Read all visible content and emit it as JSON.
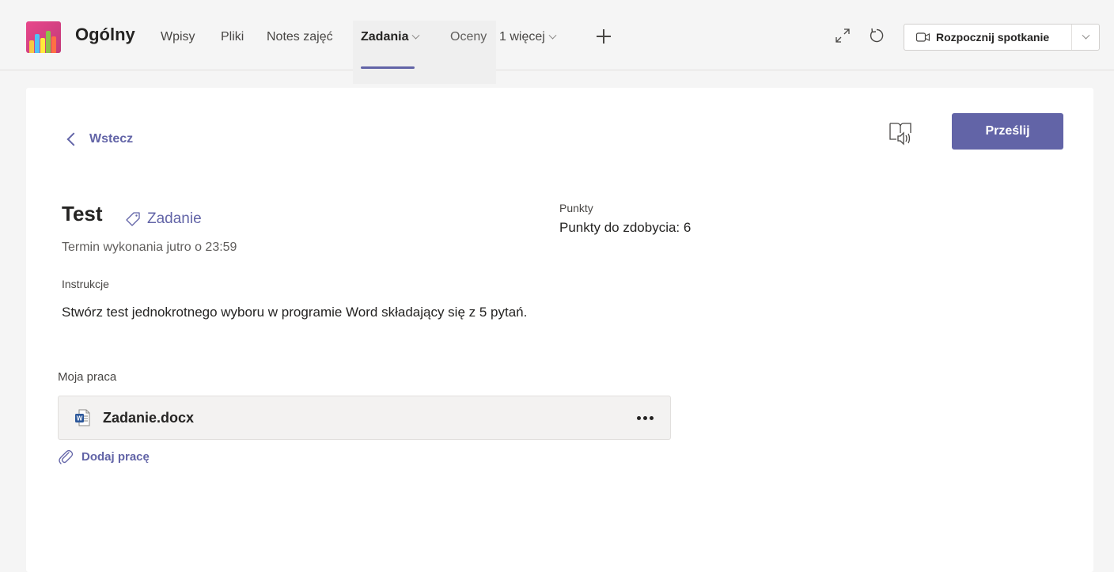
{
  "header": {
    "channel_title": "Ogólny",
    "tabs": [
      {
        "label": "Wpisy"
      },
      {
        "label": "Pliki"
      },
      {
        "label": "Notes zajęć"
      },
      {
        "label": "Zadania"
      },
      {
        "label": "Oceny"
      },
      {
        "label": "1 więcej"
      }
    ],
    "active_tab": "Zadania",
    "meet_button_label": "Rozpocznij spotkanie",
    "accent_color": "#6264a7"
  },
  "assignment": {
    "back_label": "Wstecz",
    "submit_label": "Prześlij",
    "title": "Test",
    "category_label": "Zadanie",
    "due": "Termin wykonania jutro o 23:59",
    "points_label": "Punkty",
    "points_value": "Punkty do zdobycia: 6",
    "instructions_label": "Instrukcje",
    "instructions_text": "Stwórz test jednokrotnego wyboru w programie Word składający się z 5 pytań.",
    "my_work_label": "Moja praca",
    "files": [
      {
        "name": "Zadanie.docx",
        "type": "word-icon"
      }
    ],
    "add_work_label": "Dodaj pracę"
  }
}
